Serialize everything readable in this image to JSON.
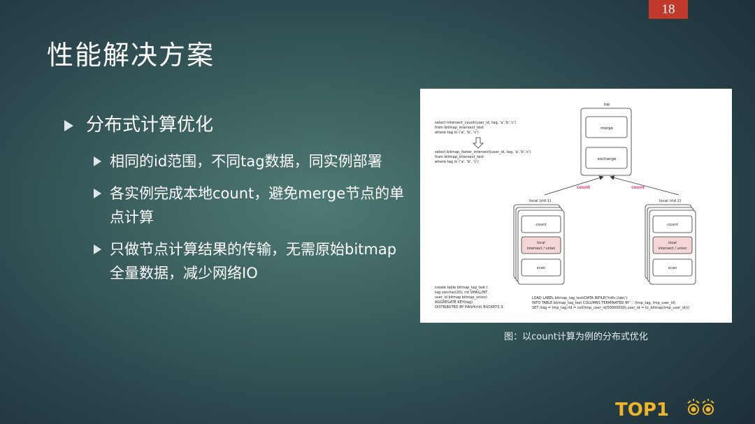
{
  "page_number": "18",
  "title": "性能解决方案",
  "bullets": {
    "level1": "分布式计算优化",
    "items": [
      "相同的id范围，不同tag数据，同实例部署",
      "各实例完成本地count，避免merge节点的单点计算",
      "只做节点计算结果的传输，无需原始bitmap全量数据，减少网络IO"
    ]
  },
  "diagram": {
    "sql_query1": [
      "select intersect_count(user_id, tag, 'a','b','c')",
      "from bitmap_intersect_test",
      "where tag in ('a', 'b', 'c')"
    ],
    "sql_query2": [
      "select bitmap_faster_intersect(user_id, tag, 'a','b','c')",
      "from bitmap_intersect_test",
      "where tag in ('a', 'b', 'c')"
    ],
    "top_label": "top",
    "merge_label": "merge",
    "exchange_label": "exchange",
    "count_arrow_left": "count",
    "count_arrow_right": "count",
    "local_left": "local   (rid 1)",
    "local_right": "local   (rid 2)",
    "count_box": "count",
    "local_op_line1": "local",
    "local_op_line2": "intersect / union",
    "scan_box": "scan",
    "create_table": [
      "create table bitmap_tag_test (",
      "tag varchar(20),  rid SMALLINT,",
      "user_id bitmap bitmap_union)",
      "AGGREGATE KEY(tag)",
      "DISTRIBUTED BY HASH(rid) BUCKETS 3;"
    ],
    "load_label": [
      "LOAD LABEL bitmap_tag_test(DATA INFILE('hdfs://abc')",
      "INTO TABLE bitmap_tag_test COLUMNS TERMINATED BY ',' (tmp_tag, tmp_user_id)",
      "SET (tag = tmp_tag,rid = ceil(tmp_user_id/50000000),user_id = to_bitmap(tmp_user_id)))"
    ]
  },
  "caption": "图：以count计算为例的分布式优化",
  "logo": "TOP1",
  "colors": {
    "accent": "#c0392b",
    "logo": "#f0b429",
    "highlight_box": "#f4d6d6",
    "count_arrow": "#e0407a"
  }
}
